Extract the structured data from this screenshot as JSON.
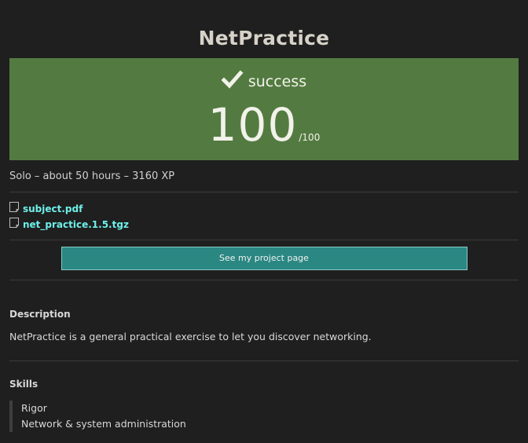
{
  "project": {
    "title": "NetPractice"
  },
  "result": {
    "status": "success",
    "score": "100",
    "score_max": "/100",
    "bg_color": "#537b41",
    "icon": "check-icon"
  },
  "meta": {
    "text": "Solo – about 50 hours – 3160 XP"
  },
  "files": [
    {
      "label": "subject.pdf",
      "icon": "file-icon"
    },
    {
      "label": "net_practice.1.5.tgz",
      "icon": "file-icon"
    }
  ],
  "actions": {
    "project_page_label": "See my project page",
    "button_color": "#2a8782",
    "link_color": "#6ef0ea"
  },
  "description": {
    "heading": "Description",
    "text": "NetPractice is a general practical exercise to let you discover networking."
  },
  "skills": {
    "heading": "Skills",
    "items": [
      "Rigor",
      "Network & system administration"
    ]
  }
}
